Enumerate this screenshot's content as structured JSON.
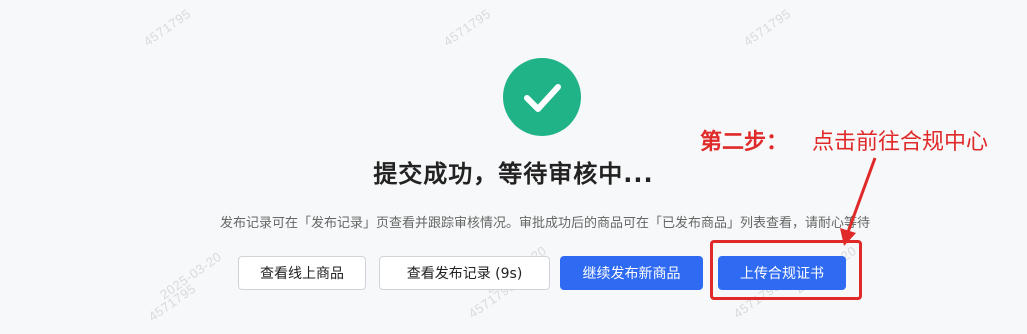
{
  "watermark": {
    "id": "4571795",
    "date": "2025-03-20"
  },
  "status": {
    "icon": "check-circle-icon",
    "title": "提交成功，等待审核中...",
    "description": "发布记录可在「发布记录」页查看并跟踪审核情况。审批成功后的商品可在「已发布商品」列表查看，请耐心等待"
  },
  "actions": {
    "view_online_products": "查看线上商品",
    "view_publish_records": "查看发布记录 (9s)",
    "continue_publish": "继续发布新商品",
    "upload_compliance": "上传合规证书"
  },
  "annotation": {
    "step_label": "第二步：",
    "step_text": "点击前往合规中心",
    "color": "#e02a2a"
  },
  "colors": {
    "success": "#1fb387",
    "primary": "#2f6bf2"
  }
}
